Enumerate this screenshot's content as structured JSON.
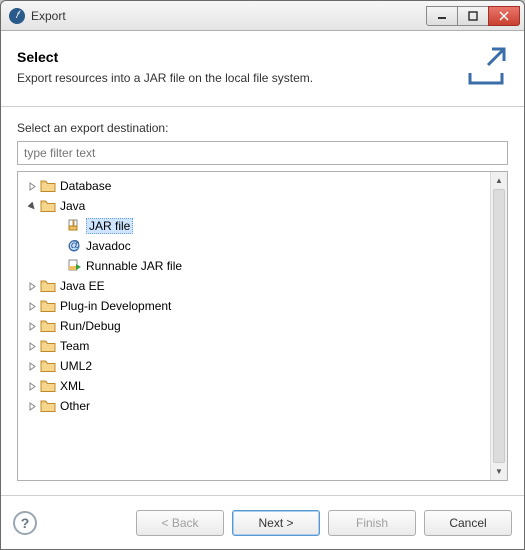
{
  "window": {
    "title": "Export"
  },
  "header": {
    "title": "Select",
    "description": "Export resources into a JAR file on the local file system."
  },
  "body": {
    "destination_label": "Select an export destination:",
    "filter_placeholder": "type filter text"
  },
  "tree": {
    "items": [
      {
        "label": "Database",
        "kind": "folder",
        "expanded": false,
        "depth": 1
      },
      {
        "label": "Java",
        "kind": "folder",
        "expanded": true,
        "depth": 1
      },
      {
        "label": "JAR file",
        "kind": "jar",
        "depth": 2,
        "selected": true
      },
      {
        "label": "Javadoc",
        "kind": "javadoc",
        "depth": 2,
        "selected": false
      },
      {
        "label": "Runnable JAR file",
        "kind": "runjar",
        "depth": 2,
        "selected": false
      },
      {
        "label": "Java EE",
        "kind": "folder",
        "expanded": false,
        "depth": 1
      },
      {
        "label": "Plug-in Development",
        "kind": "folder",
        "expanded": false,
        "depth": 1
      },
      {
        "label": "Run/Debug",
        "kind": "folder",
        "expanded": false,
        "depth": 1
      },
      {
        "label": "Team",
        "kind": "folder",
        "expanded": false,
        "depth": 1
      },
      {
        "label": "UML2",
        "kind": "folder",
        "expanded": false,
        "depth": 1
      },
      {
        "label": "XML",
        "kind": "folder",
        "expanded": false,
        "depth": 1
      },
      {
        "label": "Other",
        "kind": "folder",
        "expanded": false,
        "depth": 1
      }
    ]
  },
  "footer": {
    "back": "< Back",
    "next": "Next >",
    "finish": "Finish",
    "cancel": "Cancel"
  },
  "icons": {
    "folder_fill": "#f7d58a",
    "folder_stroke": "#c08a2a"
  }
}
